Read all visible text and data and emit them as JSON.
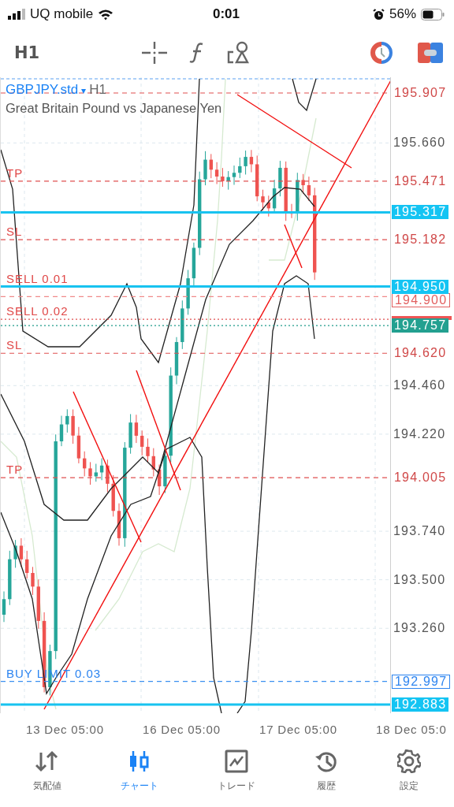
{
  "status_bar": {
    "carrier": "UQ mobile",
    "time": "0:01",
    "battery": "56%"
  },
  "toolbar": {
    "timeframe": "H1"
  },
  "chart": {
    "symbol": "GBPJPY.std",
    "symbol_caret": "▾",
    "timeframe": "H1",
    "description": "Great Britain Pound vs Japanese Yen",
    "price_ticks": [
      "195.660",
      "194.460",
      "194.220",
      "193.740",
      "193.500",
      "193.260"
    ],
    "levels": [
      {
        "price": "195.907",
        "kind": "order"
      },
      {
        "label": "TP",
        "price": "195.471",
        "kind": "order"
      },
      {
        "price": "195.317",
        "kind": "position"
      },
      {
        "label": "SL",
        "price": "195.182",
        "kind": "order"
      },
      {
        "label": "SELL 0.01",
        "price": "194.950",
        "kind": "position"
      },
      {
        "price": "194.900",
        "kind": "open"
      },
      {
        "label": "SELL 0.02",
        "kind": "ask"
      },
      {
        "price": "194.757",
        "kind": "bid"
      },
      {
        "label": "SL",
        "price": "194.620",
        "kind": "order"
      },
      {
        "label": "TP",
        "price": "194.005",
        "kind": "order"
      },
      {
        "label": "BUY LIMIT 0.03",
        "price": "192.997",
        "kind": "pending"
      },
      {
        "price": "192.883",
        "kind": "position"
      }
    ],
    "time_labels": [
      "13 Dec 05:00",
      "16 Dec 05:00",
      "17 Dec 05:00",
      "18 Dec 05:0"
    ]
  },
  "tabs": [
    {
      "label": "気配値",
      "selected": false
    },
    {
      "label": "チャート",
      "selected": true
    },
    {
      "label": "トレード",
      "selected": false
    },
    {
      "label": "履歴",
      "selected": false
    },
    {
      "label": "設定",
      "selected": false
    }
  ]
}
